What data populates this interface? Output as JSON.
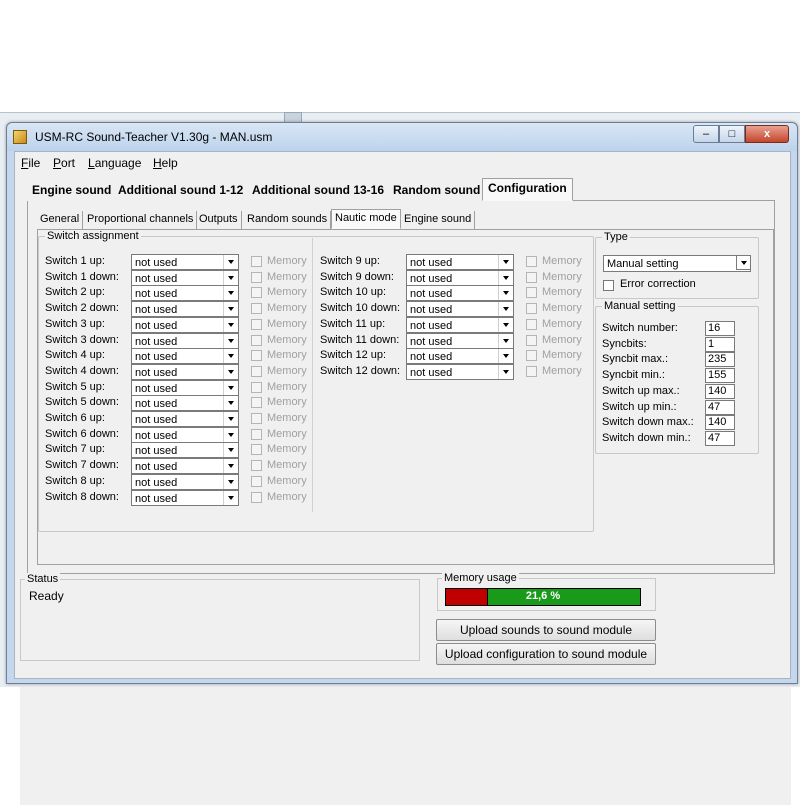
{
  "window": {
    "title": "USM-RC Sound-Teacher V1.30g - MAN.usm",
    "buttons": {
      "minimize": "–",
      "maximize": "□",
      "close": "x"
    }
  },
  "menu": [
    "File",
    "Port",
    "Language",
    "Help"
  ],
  "top_tabs": [
    "Engine sound",
    "Additional sound 1-12",
    "Additional sound 13-16",
    "Random sound",
    "Configuration"
  ],
  "active_top_tab": "Configuration",
  "sub_tabs": [
    "General",
    "Proportional channels",
    "Outputs",
    "Random sounds",
    "Nautic mode",
    "Engine sound"
  ],
  "active_sub_tab": "Nautic mode",
  "switch_assignment": {
    "title": "Switch assignment",
    "memory_label": "Memory",
    "left_rows": [
      {
        "label": "Switch 1 up:",
        "value": "not used"
      },
      {
        "label": "Switch 1 down:",
        "value": "not used"
      },
      {
        "label": "Switch 2 up:",
        "value": "not used"
      },
      {
        "label": "Switch 2 down:",
        "value": "not used"
      },
      {
        "label": "Switch 3 up:",
        "value": "not used"
      },
      {
        "label": "Switch 3 down:",
        "value": "not used"
      },
      {
        "label": "Switch 4 up:",
        "value": "not used"
      },
      {
        "label": "Switch 4 down:",
        "value": "not used"
      },
      {
        "label": "Switch 5 up:",
        "value": "not used"
      },
      {
        "label": "Switch 5 down:",
        "value": "not used"
      },
      {
        "label": "Switch 6 up:",
        "value": "not used"
      },
      {
        "label": "Switch 6 down:",
        "value": "not used"
      },
      {
        "label": "Switch 7 up:",
        "value": "not used"
      },
      {
        "label": "Switch 7 down:",
        "value": "not used"
      },
      {
        "label": "Switch 8 up:",
        "value": "not used"
      },
      {
        "label": "Switch 8 down:",
        "value": "not used"
      }
    ],
    "right_rows": [
      {
        "label": "Switch 9 up:",
        "value": "not used"
      },
      {
        "label": "Switch 9 down:",
        "value": "not used"
      },
      {
        "label": "Switch 10 up:",
        "value": "not used"
      },
      {
        "label": "Switch 10 down:",
        "value": "not used"
      },
      {
        "label": "Switch 11 up:",
        "value": "not used"
      },
      {
        "label": "Switch 11 down:",
        "value": "not used"
      },
      {
        "label": "Switch 12 up:",
        "value": "not used"
      },
      {
        "label": "Switch 12 down:",
        "value": "not used"
      }
    ]
  },
  "type_group": {
    "title": "Type",
    "selected": "Manual setting",
    "error_correction_label": "Error correction",
    "error_correction_checked": false
  },
  "manual_setting": {
    "title": "Manual setting",
    "fields": [
      {
        "label": "Switch number:",
        "value": "16"
      },
      {
        "label": "Syncbits:",
        "value": "1"
      },
      {
        "label": "Syncbit max.:",
        "value": "235"
      },
      {
        "label": "Syncbit min.:",
        "value": "155"
      },
      {
        "label": "Switch up max.:",
        "value": "140"
      },
      {
        "label": "Switch up min.:",
        "value": "47"
      },
      {
        "label": "Switch down max.:",
        "value": "140"
      },
      {
        "label": "Switch down min.:",
        "value": "47"
      }
    ]
  },
  "status": {
    "title": "Status",
    "text": "Ready"
  },
  "memory_usage": {
    "title": "Memory usage",
    "percent_text": "21,6 %",
    "fraction": 0.216,
    "used_color": "#c00000",
    "free_color": "#1a9a1a"
  },
  "buttons": {
    "upload_sounds": "Upload sounds to sound module",
    "upload_config": "Upload configuration to sound module"
  }
}
